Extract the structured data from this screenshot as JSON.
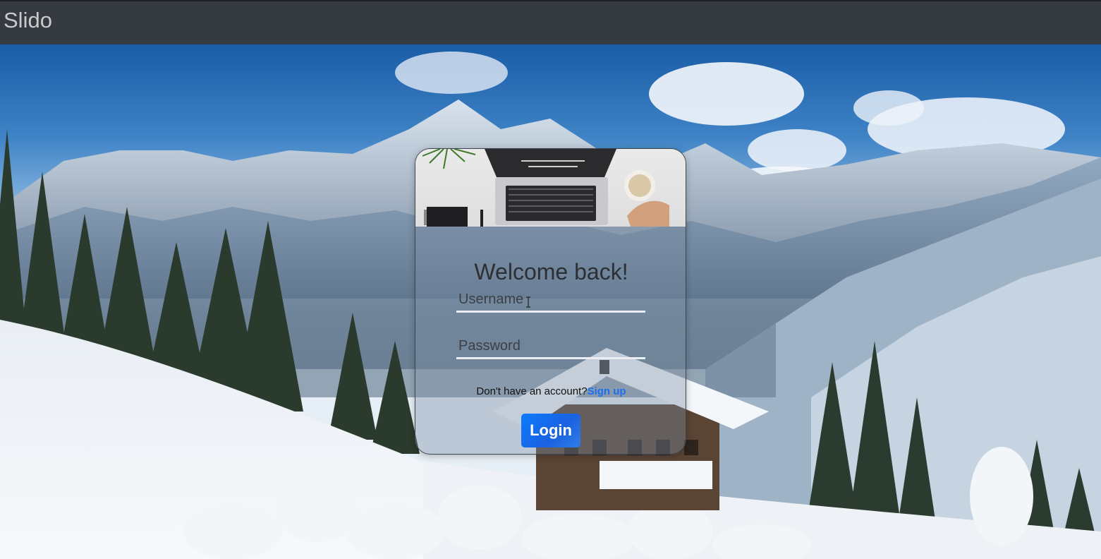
{
  "navbar": {
    "brand": "Slido"
  },
  "login": {
    "title": "Welcome back!",
    "username_placeholder": "Username",
    "password_placeholder": "Password",
    "signup_prompt": "Don't have an account?",
    "signup_link": "Sign up",
    "login_button": "Login"
  },
  "colors": {
    "navbar": "#343a40",
    "brand_text": "#c9cbcd",
    "link": "#1a6ff0",
    "button": "#0d7bff"
  },
  "icons": [
    "text-cursor-icon"
  ]
}
